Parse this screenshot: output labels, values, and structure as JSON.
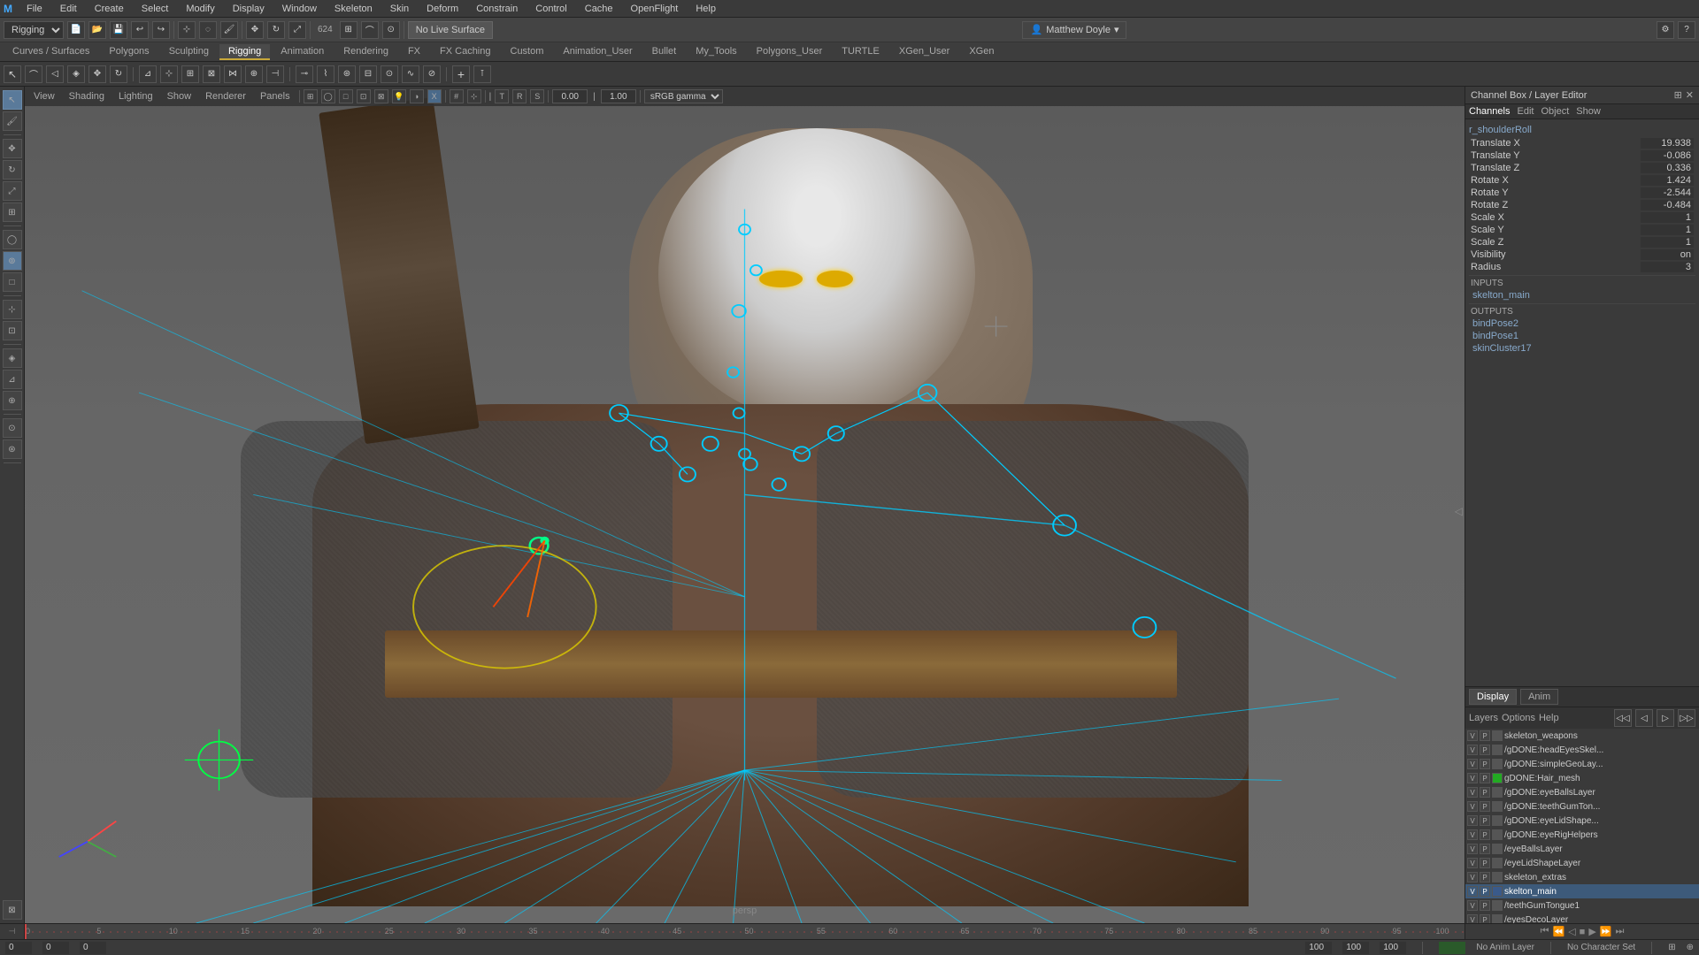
{
  "app": {
    "title": "Autodesk Maya"
  },
  "menu": {
    "items": [
      "File",
      "Edit",
      "Create",
      "Select",
      "Modify",
      "Display",
      "Window",
      "Skeleton",
      "Skin",
      "Deform",
      "Constrain",
      "Control",
      "Cache",
      "OpenFlight",
      "Help"
    ]
  },
  "toolbar1": {
    "mode_select": "Rigging",
    "no_live_surface": "No Live Surface",
    "user": "Matthew Doyle"
  },
  "tabs": {
    "items": [
      "Curves / Surfaces",
      "Polygons",
      "Sculpting",
      "Rigging",
      "Animation",
      "Rendering",
      "FX",
      "FX Caching",
      "Custom",
      "Animation_User",
      "Bullet",
      "My_Tools",
      "Polygons_User",
      "TURTLE",
      "XGen_User",
      "XGen"
    ],
    "active": "Rigging"
  },
  "toolbar2": {
    "menus": [
      "View",
      "Shading",
      "Lighting",
      "Show",
      "Renderer",
      "Panels"
    ]
  },
  "viewport": {
    "label": "persp"
  },
  "right_panel": {
    "title": "Channel Box / Layer Editor",
    "tabs": [
      "Channels",
      "Edit",
      "Object",
      "Show"
    ],
    "node_name": "r_shoulderRoll",
    "attributes": [
      {
        "label": "Translate X",
        "value": "19.938",
        "highlight": false
      },
      {
        "label": "Translate Y",
        "value": "-0.086",
        "highlight": false
      },
      {
        "label": "Translate Z",
        "value": "0.336",
        "highlight": false
      },
      {
        "label": "Rotate X",
        "value": "1.424",
        "highlight": false
      },
      {
        "label": "Rotate Y",
        "value": "-2.544",
        "highlight": false
      },
      {
        "label": "Rotate Z",
        "value": "-0.484",
        "highlight": false
      },
      {
        "label": "Scale X",
        "value": "1",
        "highlight": false
      },
      {
        "label": "Scale Y",
        "value": "1",
        "highlight": false
      },
      {
        "label": "Scale Z",
        "value": "1",
        "highlight": false
      },
      {
        "label": "Visibility",
        "value": "on",
        "highlight": false
      },
      {
        "label": "Radius",
        "value": "3",
        "highlight": false
      }
    ],
    "inputs_label": "INPUTS",
    "inputs": [
      "skelton_main"
    ],
    "outputs_label": "OUTPUTS",
    "outputs": [
      "bindPose2",
      "bindPose1",
      "skinCluster17"
    ]
  },
  "display_anim": {
    "tabs": [
      "Display",
      "Anim"
    ],
    "active": "Display"
  },
  "layers_toolbar": {
    "labels": [
      "Layers",
      "Options",
      "Help"
    ]
  },
  "layers": [
    {
      "vp": "V",
      "rp": "P",
      "color": "#666",
      "name": "skeleton_weapons",
      "active": false
    },
    {
      "vp": "V",
      "rp": "P",
      "color": "#666",
      "name": "/gDONE:headEyesSkel...",
      "active": false
    },
    {
      "vp": "V",
      "rp": "P",
      "color": "#666",
      "name": "/gDONE:simpleGeoLay...",
      "active": false
    },
    {
      "vp": "V",
      "rp": "P",
      "color": "#22aa22",
      "name": "gDONE:Hair_mesh",
      "active": false
    },
    {
      "vp": "V",
      "rp": "P",
      "color": "#666",
      "name": "/gDONE:eyeBallsLayer",
      "active": false
    },
    {
      "vp": "V",
      "rp": "P",
      "color": "#666",
      "name": "/gDONE:teethGumTon...",
      "active": false
    },
    {
      "vp": "V",
      "rp": "P",
      "color": "#666",
      "name": "/gDONE:eyeLidShape...",
      "active": false
    },
    {
      "vp": "V",
      "rp": "P",
      "color": "#666",
      "name": "/gDONE:eyeRigHelpers",
      "active": false
    },
    {
      "vp": "V",
      "rp": "P",
      "color": "#666",
      "name": "/eyeBallsLayer",
      "active": false
    },
    {
      "vp": "V",
      "rp": "P",
      "color": "#666",
      "name": "/eyeLidShapeLayer",
      "active": false
    },
    {
      "vp": "V",
      "rp": "P",
      "color": "#666",
      "name": "skeleton_extras",
      "active": false
    },
    {
      "vp": "V",
      "rp": "P",
      "color": "#3a5a8a",
      "name": "skelton_main",
      "active": true
    },
    {
      "vp": "V",
      "rp": "P",
      "color": "#666",
      "name": "/teethGumTongue1",
      "active": false
    },
    {
      "vp": "V",
      "rp": "P",
      "color": "#666",
      "name": "/eyesDecoLayer",
      "active": false
    }
  ],
  "timeline": {
    "start": 0,
    "end": 100,
    "current": 0,
    "ticks": [
      "0",
      "5",
      "10",
      "15",
      "20",
      "25",
      "30",
      "35",
      "40",
      "45",
      "50",
      "55",
      "60",
      "65",
      "70",
      "75",
      "80",
      "85",
      "90",
      "95",
      "100"
    ]
  },
  "status_bar": {
    "frame_start": "0",
    "frame_current": "0",
    "frame_marker": "0",
    "frame_end_range": "100",
    "frame_end": "100",
    "frame_end2": "100",
    "anim_layer": "No Anim Layer",
    "char_set": "No Character Set"
  }
}
